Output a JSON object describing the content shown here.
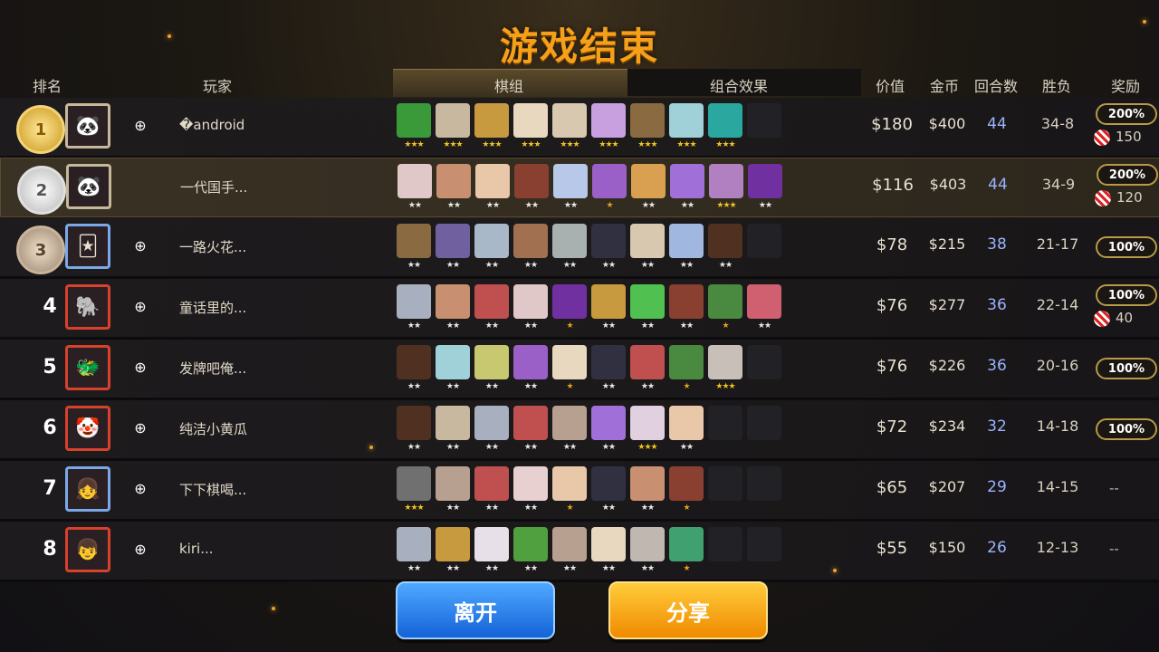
{
  "title": "游戏结束",
  "headers": {
    "rank": "排名",
    "player": "玩家",
    "lineup": "棋组",
    "synergy": "组合效果",
    "value": "价值",
    "gold": "金币",
    "rounds": "回合数",
    "winloss": "胜负",
    "reward": "奖励"
  },
  "rows": [
    {
      "rank": "1",
      "medal": "gold",
      "avatar": "panda-avatar",
      "name": "�android",
      "value": "$180",
      "gold": "$400",
      "rounds": "44",
      "wl": "34-8",
      "reward": "200%",
      "candy": "150",
      "units": [
        3,
        3,
        3,
        3,
        3,
        3,
        3,
        3,
        3,
        0
      ],
      "unit_colors": [
        "#3a9a3a",
        "#c8b8a0",
        "#c89a40",
        "#e8d8c0",
        "#d8c8b0",
        "#c8a0e0",
        "#8a6a40",
        "#a0d0d8",
        "#2aa8a0",
        ""
      ]
    },
    {
      "rank": "2",
      "medal": "silver",
      "avatar": "panda-avatar",
      "name": "一代国手...",
      "value": "$116",
      "gold": "$403",
      "rounds": "44",
      "wl": "34-9",
      "reward": "200%",
      "candy": "120",
      "units": [
        2,
        2,
        2,
        2,
        2,
        1,
        2,
        2,
        3,
        2
      ],
      "unit_colors": [
        "#e0c8c8",
        "#c89070",
        "#e8c8a8",
        "#8a4030",
        "#b8c8e8",
        "#9a60c8",
        "#d8a050",
        "#a070d8",
        "#b080c0",
        "#7030a0"
      ]
    },
    {
      "rank": "3",
      "medal": "bronze",
      "avatar": "joker-avatar",
      "name": "一路火花...",
      "value": "$78",
      "gold": "$215",
      "rounds": "38",
      "wl": "21-17",
      "reward": "100%",
      "candy": "",
      "units": [
        2,
        2,
        2,
        2,
        2,
        2,
        2,
        2,
        2,
        0
      ],
      "unit_colors": [
        "#8a6a40",
        "#7060a0",
        "#a8b8c8",
        "#a07050",
        "#a8b0b0",
        "#303040",
        "#d8c8b0",
        "#a0b8e0",
        "#503020",
        ""
      ]
    },
    {
      "rank": "4",
      "medal": "",
      "avatar": "elephant-avatar",
      "name": "童话里的...",
      "value": "$76",
      "gold": "$277",
      "rounds": "36",
      "wl": "22-14",
      "reward": "100%",
      "candy": "40",
      "units": [
        2,
        2,
        2,
        2,
        1,
        2,
        2,
        2,
        1,
        2
      ],
      "unit_colors": [
        "#a8b0c0",
        "#c89070",
        "#c05050",
        "#e0c8c8",
        "#7030a0",
        "#c89a40",
        "#50c050",
        "#8a4030",
        "#4a8a40",
        "#d06070"
      ]
    },
    {
      "rank": "5",
      "medal": "",
      "avatar": "dragon-avatar",
      "name": "发牌吧俺...",
      "value": "$76",
      "gold": "$226",
      "rounds": "36",
      "wl": "20-16",
      "reward": "100%",
      "candy": "",
      "units": [
        2,
        2,
        2,
        2,
        1,
        2,
        2,
        1,
        3,
        0
      ],
      "unit_colors": [
        "#503020",
        "#a0d0d8",
        "#c8c870",
        "#9a60c8",
        "#e8d8c0",
        "#303040",
        "#c05050",
        "#4a8a40",
        "#c8c0b8",
        ""
      ]
    },
    {
      "rank": "6",
      "medal": "",
      "avatar": "clown-avatar",
      "name": "纯洁小黄瓜",
      "value": "$72",
      "gold": "$234",
      "rounds": "32",
      "wl": "14-18",
      "reward": "100%",
      "candy": "",
      "units": [
        2,
        2,
        2,
        2,
        2,
        2,
        3,
        2,
        0,
        0
      ],
      "unit_colors": [
        "#503020",
        "#c8b8a0",
        "#a8b0c0",
        "#c05050",
        "#b8a090",
        "#a070d8",
        "#e0d0e0",
        "#e8c8a8",
        "",
        ""
      ]
    },
    {
      "rank": "7",
      "medal": "",
      "avatar": "girl-avatar",
      "name": "下下棋喝...",
      "value": "$65",
      "gold": "$207",
      "rounds": "29",
      "wl": "14-15",
      "reward": "--",
      "candy": "",
      "units": [
        3,
        2,
        2,
        2,
        1,
        2,
        2,
        1,
        0,
        0
      ],
      "unit_colors": [
        "#707070",
        "#b8a090",
        "#c05050",
        "#e8d0d0",
        "#e8c8a8",
        "#303040",
        "#c89070",
        "#8a4030",
        "",
        ""
      ]
    },
    {
      "rank": "8",
      "medal": "",
      "avatar": "boy-avatar",
      "name": "kiri...",
      "value": "$55",
      "gold": "$150",
      "rounds": "26",
      "wl": "12-13",
      "reward": "--",
      "candy": "",
      "units": [
        2,
        2,
        2,
        2,
        2,
        2,
        2,
        1,
        0,
        0
      ],
      "unit_colors": [
        "#a8b0c0",
        "#c89a40",
        "#e8e0e8",
        "#50a040",
        "#b8a090",
        "#e8d8c0",
        "#c0b8b0",
        "#40a070",
        "",
        ""
      ]
    }
  ],
  "buttons": {
    "leave": "离开",
    "share": "分享"
  }
}
